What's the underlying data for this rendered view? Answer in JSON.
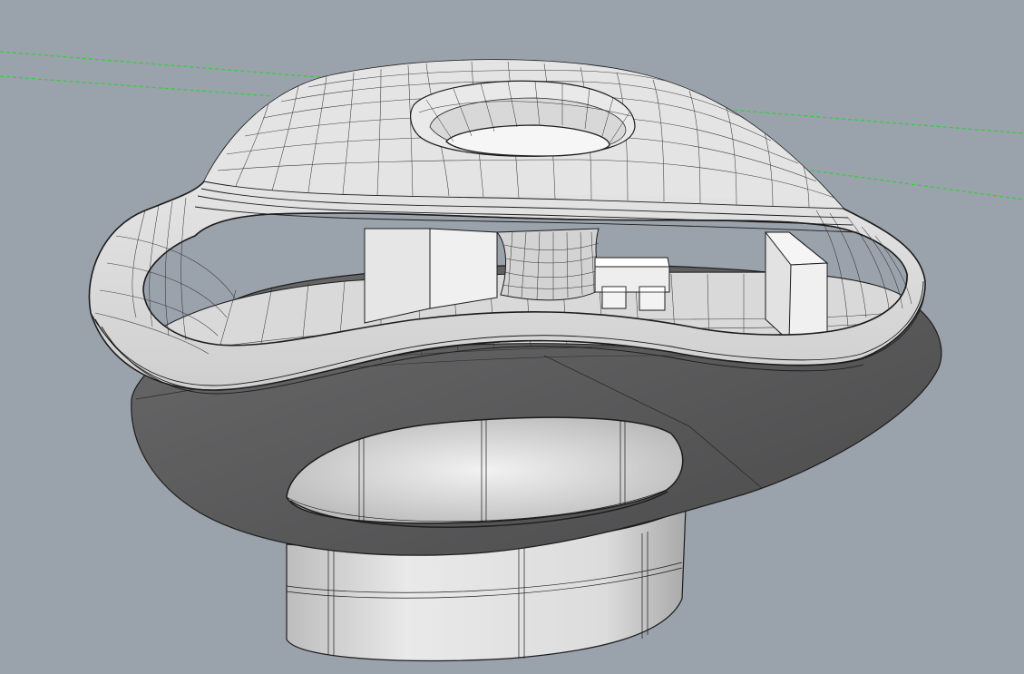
{
  "viewport": {
    "background": "#9aa2ab",
    "grid_axis_color": "#2fd13a",
    "surface_fill": "#e8e8e8",
    "surface_mid": "#cfcfcf",
    "surface_dark": "#6b6b6c",
    "edge_color": "#1c1c1c",
    "icon": "3d-model"
  }
}
